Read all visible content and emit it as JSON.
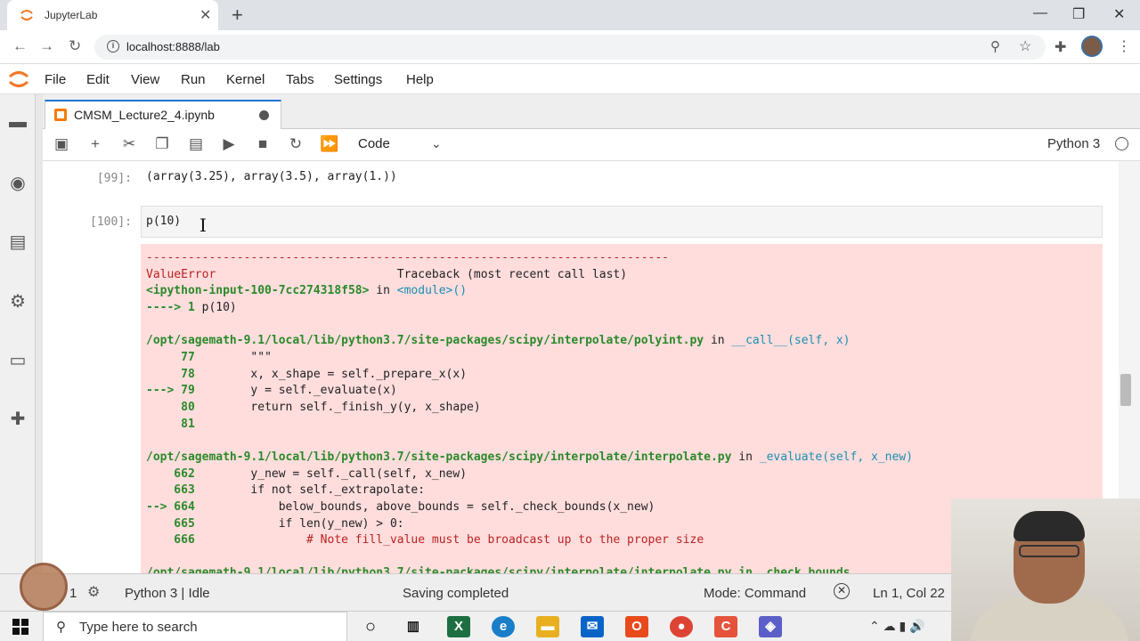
{
  "browser": {
    "tab_title": "JupyterLab",
    "url": "localhost:8888/lab"
  },
  "menu": [
    "File",
    "Edit",
    "View",
    "Run",
    "Kernel",
    "Tabs",
    "Settings",
    "Help"
  ],
  "notebook_tab": {
    "title": "CMSM_Lecture2_4.ipynb"
  },
  "toolbar": {
    "cell_type": "Code",
    "kernel": "Python 3"
  },
  "cells": {
    "out99": {
      "prompt": "[99]:",
      "text": "(array(3.25), array(3.5), array(1.))"
    },
    "in100": {
      "prompt": "[100]:",
      "code": "p(10)"
    }
  },
  "traceback": {
    "dashes": "---------------------------------------------------------------------------",
    "error_name": "ValueError",
    "header_right": "Traceback (most recent call last)",
    "input_name": "<ipython-input-100-7cc274318f58>",
    "in_word": "in",
    "module": "<module>()",
    "arrow_line_prefix": "----> 1 ",
    "arrow_line_code": "p(10)",
    "frame1": {
      "path": "/opt/sagemath-9.1/local/lib/python3.7/site-packages/scipy/interpolate/polyint.py",
      "func": "__call__(self, x)",
      "lines": [
        {
          "marker": "     77",
          "code": "        \"\"\""
        },
        {
          "marker": "     78",
          "code": "        x, x_shape = self._prepare_x(x)"
        },
        {
          "marker": "---> 79",
          "code": "        y = self._evaluate(x)"
        },
        {
          "marker": "     80",
          "code": "        return self._finish_y(y, x_shape)"
        },
        {
          "marker": "     81",
          "code": ""
        }
      ]
    },
    "frame2": {
      "path": "/opt/sagemath-9.1/local/lib/python3.7/site-packages/scipy/interpolate/interpolate.py",
      "func": "_evaluate(self, x_new)",
      "lines": [
        {
          "marker": "    662",
          "code": "        y_new = self._call(self, x_new)"
        },
        {
          "marker": "    663",
          "code": "        if not self._extrapolate:"
        },
        {
          "marker": "--> 664",
          "code": "            below_bounds, above_bounds = self._check_bounds(x_new)"
        },
        {
          "marker": "    665",
          "code": "            if len(y_new) > 0:"
        },
        {
          "marker": "    666",
          "code": "                # Note fill_value must be broadcast up to the proper size"
        }
      ]
    },
    "frame3_partial": "/opt/sagemath-9.1/local/lib/python3.7/site-packages/scipy/interpolate/interpolate.py in _check_bounds"
  },
  "statusbar": {
    "count": "1",
    "kernel": "Python 3 | Idle",
    "saving": "Saving completed",
    "mode": "Mode: Command",
    "cursor": "Ln 1, Col 22"
  },
  "taskbar": {
    "search_placeholder": "Type here to search"
  },
  "colors": {
    "error_bg": "#ffdddd",
    "accent": "#1976d2",
    "jupyter_orange": "#f37726"
  }
}
